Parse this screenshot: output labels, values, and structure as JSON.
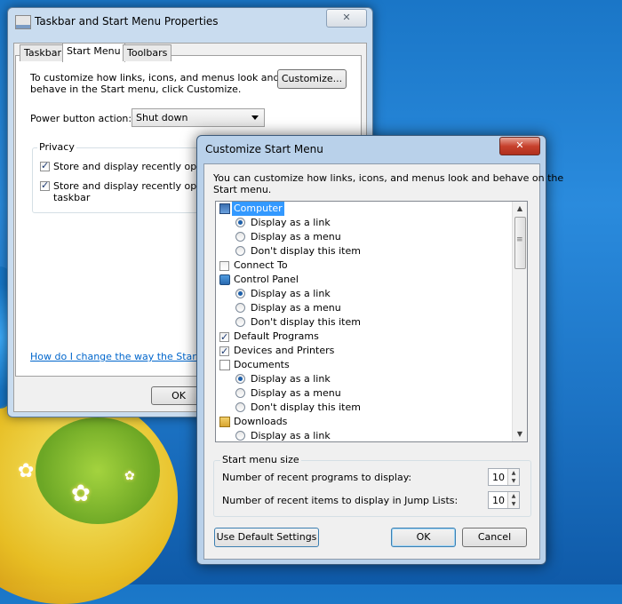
{
  "background_window": {
    "title": "Taskbar and Start Menu Properties",
    "close_label": "✕",
    "tabs": [
      "Taskbar",
      "Start Menu",
      "Toolbars"
    ],
    "intro_line1": "To customize how links, icons, and menus look and",
    "intro_line2": "behave in the Start menu, click Customize.",
    "customize_button": "Customize...",
    "power_label": "Power button action:",
    "power_value": "Shut down",
    "privacy_title": "Privacy",
    "privacy_item1": "Store and display recently opened",
    "privacy_item2_line1": "Store and display recently opened",
    "privacy_item2_line2": "taskbar",
    "help_link": "How do I change the way the Start me",
    "ok_button": "OK"
  },
  "dialog": {
    "title": "Customize Start Menu",
    "close_label": "✕",
    "intro_line1": "You can customize how links, icons, and menus look and behave on the",
    "intro_line2": "Start menu.",
    "items": {
      "computer": "Computer",
      "computer_link": "Display as a link",
      "computer_menu": "Display as a menu",
      "computer_none": "Don't display this item",
      "connect_to": "Connect To",
      "control_panel": "Control Panel",
      "cp_link": "Display as a link",
      "cp_menu": "Display as a menu",
      "cp_none": "Don't display this item",
      "default_programs": "Default Programs",
      "devices_printers": "Devices and Printers",
      "documents": "Documents",
      "doc_link": "Display as a link",
      "doc_menu": "Display as a menu",
      "doc_none": "Don't display this item",
      "downloads": "Downloads",
      "dl_link": "Display as a link"
    },
    "size_group_title": "Start menu size",
    "recent_programs_label": "Number of recent programs to display:",
    "recent_programs_value": "10",
    "jump_lists_label": "Number of recent items to display in Jump Lists:",
    "jump_lists_value": "10",
    "default_button": "Use Default Settings",
    "ok_button": "OK",
    "cancel_button": "Cancel"
  }
}
